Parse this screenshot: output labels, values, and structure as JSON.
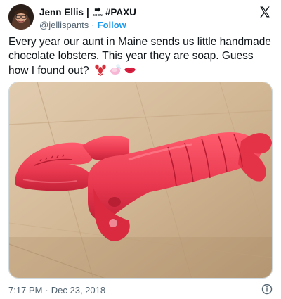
{
  "author": {
    "name": "Jenn Ellis",
    "separator": "|",
    "badge_text": "SOON",
    "hashtag": "#PAXU",
    "handle": "@jellispants",
    "dot": "·",
    "follow_label": "Follow"
  },
  "tweet": {
    "text": "Every year our aunt in Maine sends us little handmade chocolate lobsters. This year they are soap. Guess how I found out?",
    "emojis": [
      "lobster-emoji",
      "soap-emoji",
      "lips-emoji"
    ]
  },
  "footer": {
    "time": "7:17 PM",
    "dot": "·",
    "date": "Dec 23, 2018"
  },
  "icons": {
    "x_logo": "x-logo-icon",
    "info": "info-icon"
  },
  "colors": {
    "text": "#0f1419",
    "muted": "#536471",
    "accent": "#1d9bf0",
    "lobster": "#e8384f"
  }
}
